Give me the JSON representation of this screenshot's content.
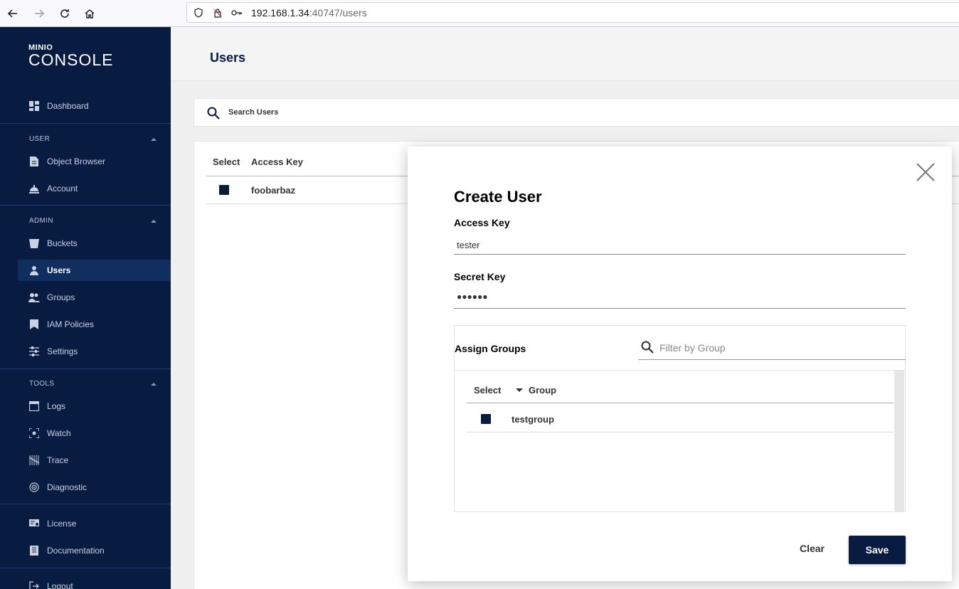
{
  "browser": {
    "url_host": "192.168.1.34",
    "url_rest": ":40747/users"
  },
  "sidebar": {
    "logo_mini": "MINIO",
    "logo_main": "CONSOLE",
    "dashboard": "Dashboard",
    "section_user": "USER",
    "object_browser": "Object Browser",
    "account": "Account",
    "section_admin": "ADMIN",
    "buckets": "Buckets",
    "users": "Users",
    "groups": "Groups",
    "iam_policies": "IAM Policies",
    "settings": "Settings",
    "section_tools": "TOOLS",
    "logs": "Logs",
    "watch": "Watch",
    "trace": "Trace",
    "diagnostic": "Diagnostic",
    "license": "License",
    "documentation": "Documentation",
    "logout": "Logout"
  },
  "main": {
    "title": "Users",
    "search_placeholder": "Search Users",
    "table": {
      "col_select": "Select",
      "col_access_key": "Access Key",
      "rows": [
        {
          "access_key": "foobarbaz"
        }
      ]
    }
  },
  "modal": {
    "title": "Create User",
    "access_key_label": "Access Key",
    "access_key_value": "tester",
    "secret_key_label": "Secret Key",
    "secret_key_value": "●●●●●●",
    "assign_groups_label": "Assign Groups",
    "filter_placeholder": "Filter by Group",
    "groups_table": {
      "col_select": "Select",
      "col_group": "Group",
      "rows": [
        {
          "group": "testgroup"
        }
      ]
    },
    "clear_label": "Clear",
    "save_label": "Save"
  },
  "colors": {
    "sidebar_bg": "#081c42",
    "accent": "#081c42"
  }
}
